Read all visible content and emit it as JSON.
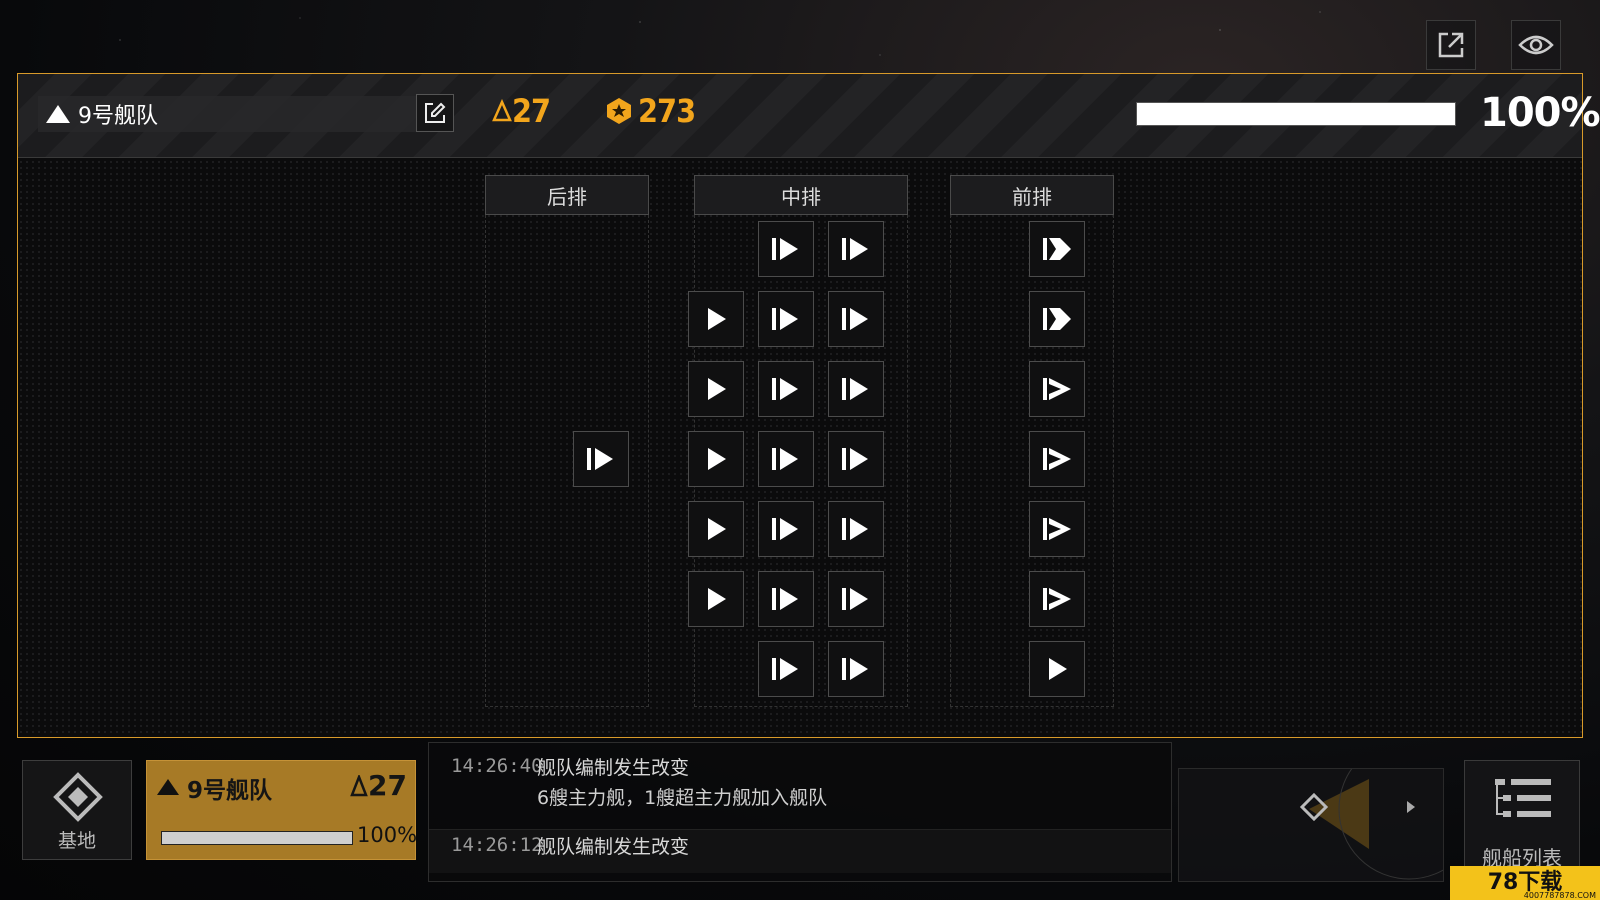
{
  "top_buttons": {
    "share": "share-icon",
    "visibility": "eye-icon"
  },
  "header": {
    "fleet_name": "9号舰队",
    "command_value": "27",
    "power_value": "273",
    "readiness": 1.0,
    "readiness_label": "100%"
  },
  "columns": {
    "back": {
      "label": "后排"
    },
    "middle": {
      "label": "中排"
    },
    "front": {
      "label": "前排"
    }
  },
  "ships": {
    "back": [
      "frigate"
    ],
    "middle": [
      "frigate",
      "frigate",
      "fighter",
      "frigate",
      "frigate",
      "fighter",
      "frigate",
      "frigate",
      "fighter",
      "frigate",
      "frigate",
      "fighter",
      "frigate",
      "frigate",
      "fighter",
      "frigate",
      "frigate",
      "frigate",
      "frigate"
    ],
    "front": [
      "cruiser",
      "cruiser",
      "destroyer",
      "destroyer",
      "destroyer",
      "destroyer",
      "fighter"
    ]
  },
  "bottom": {
    "base_label": "基地",
    "fleet_card": {
      "name": "9号舰队",
      "power": "27",
      "readiness": 1.0,
      "readiness_label": "100%"
    },
    "ship_list_label": "舰船列表"
  },
  "log": [
    {
      "time": "14:26:40",
      "title": "舰队编制发生改变",
      "detail": "6艘主力舰，1艘超主力舰加入舰队"
    },
    {
      "time": "14:26:12",
      "title": "舰队编制发生改变"
    }
  ],
  "watermark": {
    "text": "78下载",
    "sub": "4007787878.COM"
  },
  "colors": {
    "accent": "#f2a51c",
    "border": "#d89a2a",
    "card": "#a77a26"
  }
}
